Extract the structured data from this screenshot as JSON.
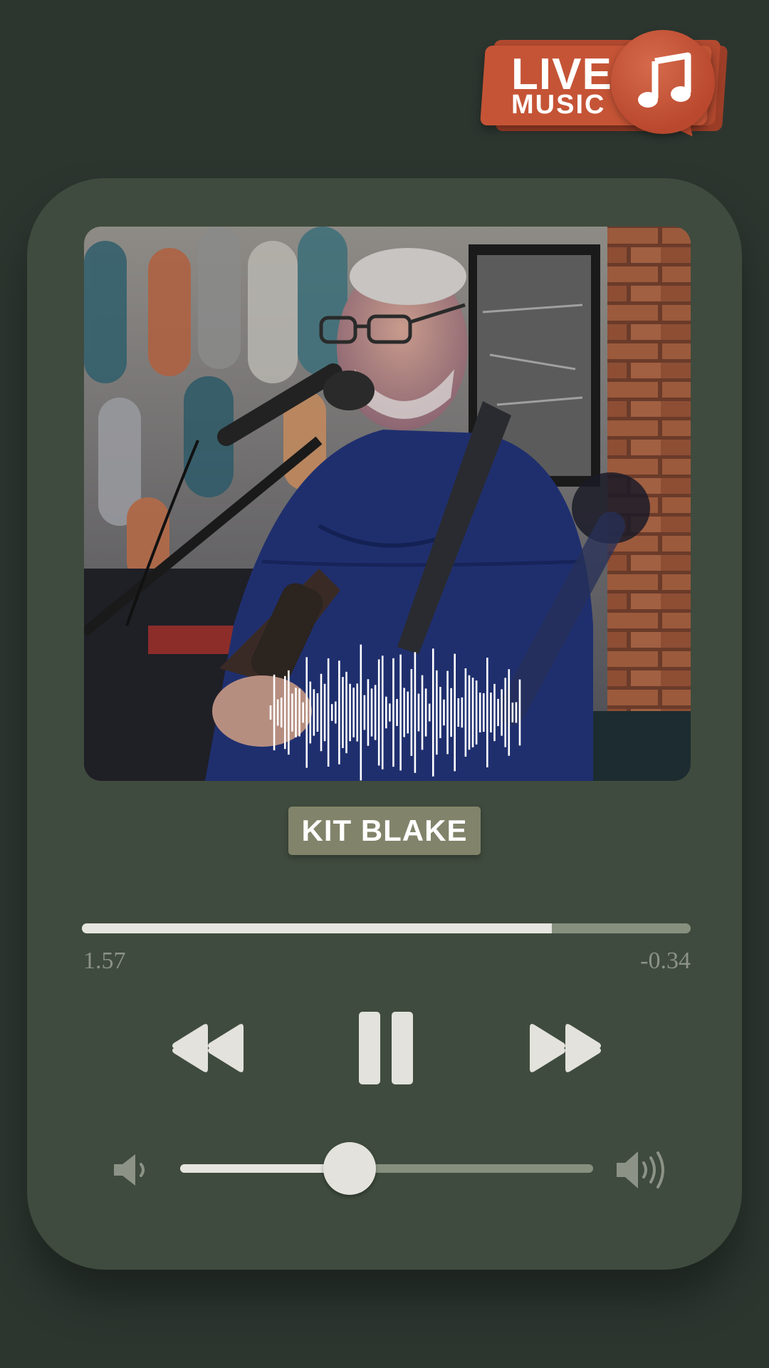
{
  "badge": {
    "line1": "LIVE",
    "line2": "MUSIC",
    "icon": "music-note-icon",
    "color": "#c55436"
  },
  "artist": {
    "name": "KIT BLAKE"
  },
  "playback": {
    "elapsed": "1.57",
    "remaining": "-0.34",
    "progress": 0.772,
    "state": "playing"
  },
  "controls": {
    "rewind_icon": "rewind-icon",
    "pause_icon": "pause-icon",
    "forward_icon": "fast-forward-icon"
  },
  "volume": {
    "level": 0.41,
    "low_icon": "volume-low-icon",
    "high_icon": "volume-high-icon"
  },
  "theme": {
    "background": "#2c362f",
    "card": "#3f4b3e",
    "accent": "#e6e5df",
    "badge": "#81846a"
  }
}
